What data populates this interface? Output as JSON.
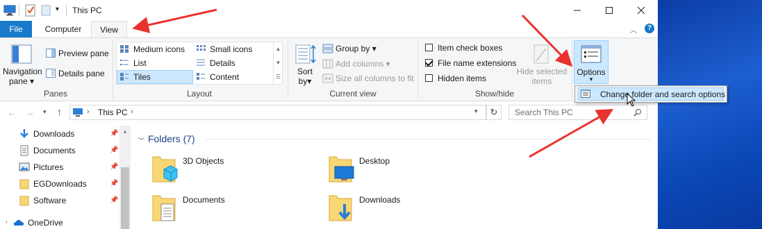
{
  "window": {
    "title": "This PC",
    "controls": [
      "minimize",
      "maximize",
      "close"
    ]
  },
  "ribbon": {
    "tabs": [
      "File",
      "Computer",
      "View"
    ],
    "active_tab": "View",
    "panes": {
      "navigation_pane_line1": "Navigation",
      "navigation_pane_line2": "pane",
      "preview_pane": "Preview pane",
      "details_pane": "Details pane",
      "group_label": "Panes"
    },
    "layout": {
      "items": [
        "Medium icons",
        "Small icons",
        "List",
        "Details",
        "Tiles",
        "Content"
      ],
      "selected": "Tiles",
      "group_label": "Layout"
    },
    "current_view": {
      "sort_by_line1": "Sort",
      "sort_by_line2": "by",
      "group_by": "Group by",
      "add_columns": "Add columns",
      "size_all_columns": "Size all columns to fit",
      "group_label": "Current view"
    },
    "show_hide": {
      "item_check_boxes": "Item check boxes",
      "file_name_extensions": "File name extensions",
      "hidden_items": "Hidden items",
      "hide_selected_line1": "Hide selected",
      "hide_selected_line2": "items",
      "checked": {
        "item_check_boxes": false,
        "file_name_extensions": true,
        "hidden_items": false
      },
      "group_label": "Show/hide"
    },
    "options": {
      "label": "Options",
      "dropdown_item": "Change folder and search options"
    }
  },
  "address": {
    "location": "This PC",
    "search_placeholder": "Search This PC"
  },
  "nav_pane": {
    "items": [
      "Downloads",
      "Documents",
      "Pictures",
      "EGDownloads",
      "Software",
      "OneDrive"
    ]
  },
  "content": {
    "section_title": "Folders (7)",
    "folders": [
      "3D Objects",
      "Desktop",
      "Documents",
      "Downloads"
    ]
  },
  "colors": {
    "file_tab": "#1979ca",
    "ribbon_bg": "#f5f6f7",
    "selection": "#cce8ff",
    "annotation_arrow": "#e8322e",
    "folder_yellow": "#f8d775"
  }
}
